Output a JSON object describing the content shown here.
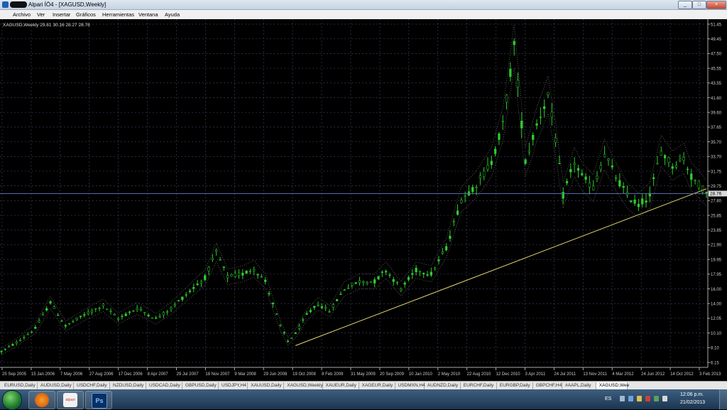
{
  "window": {
    "title": "Alpari ÍÖ4 - [XAGUSD,Weekly]",
    "controls": [
      "_",
      "□",
      "×"
    ]
  },
  "menu": [
    "Archivo",
    "Ver",
    "Insertar",
    "Gráficos",
    "Herramientas",
    "Ventana",
    "Ayuda"
  ],
  "chart_info": "XAGUSD,Weekly  29.81 30.16 28.27 28.76",
  "chart_data": {
    "type": "candlestick",
    "symbol": "XAGUSD",
    "timeframe": "Weekly",
    "last_ohlc": {
      "open": 29.81,
      "high": 30.16,
      "low": 28.27,
      "close": 28.76
    },
    "current_price_label": "28.76",
    "ylim": [
      6.15,
      51.45
    ],
    "y_ticks": [
      "51.45",
      "49.45",
      "47.50",
      "45.55",
      "43.55",
      "41.60",
      "39.60",
      "37.65",
      "35.70",
      "33.70",
      "31.75",
      "29.75",
      "27.80",
      "25.85",
      "23.85",
      "21.90",
      "19.95",
      "17.95",
      "16.00",
      "14.00",
      "12.05",
      "10.10",
      "8.10",
      "6.15"
    ],
    "x_ticks": [
      "25 Sep 2005",
      "15 Jan 2006",
      "7 May 2006",
      "27 Aug 2006",
      "17 Dec 2006",
      "8 Apr 2007",
      "29 Jul 2007",
      "18 Nov 2007",
      "9 Mar 2008",
      "29 Jun 2008",
      "19 Oct 2008",
      "8 Feb 2009",
      "31 May 2009",
      "20 Sep 2009",
      "10 Jan 2010",
      "2 May 2010",
      "22 Aug 2010",
      "12 Dec 2010",
      "3 Apr 2011",
      "24 Jul 2011",
      "13 Nov 2011",
      "4 Mar 2012",
      "24 Jun 2012",
      "14 Oct 2012",
      "3 Feb 2013"
    ],
    "price_path": [
      [
        0,
        7.6
      ],
      [
        4,
        8.8
      ],
      [
        9,
        10.7
      ],
      [
        13,
        14.2
      ],
      [
        17,
        11.0
      ],
      [
        22,
        12.5
      ],
      [
        27,
        13.8
      ],
      [
        31,
        12.0
      ],
      [
        36,
        13.4
      ],
      [
        41,
        12.0
      ],
      [
        45,
        13.4
      ],
      [
        50,
        15.7
      ],
      [
        54,
        17.5
      ],
      [
        57,
        20.9
      ],
      [
        60,
        17.6
      ],
      [
        64,
        18.0
      ],
      [
        67,
        18.7
      ],
      [
        70,
        17.0
      ],
      [
        72,
        14.0
      ],
      [
        74,
        11.0
      ],
      [
        76,
        9.0
      ],
      [
        78,
        10.0
      ],
      [
        81,
        12.5
      ],
      [
        84,
        14.0
      ],
      [
        87,
        13.0
      ],
      [
        91,
        16.0
      ],
      [
        95,
        17.0
      ],
      [
        99,
        17.0
      ],
      [
        102,
        18.5
      ],
      [
        106,
        16.0
      ],
      [
        110,
        18.5
      ],
      [
        114,
        18.0
      ],
      [
        118,
        21.5
      ],
      [
        122,
        28.0
      ],
      [
        126,
        30.0
      ],
      [
        130,
        33.0
      ],
      [
        133,
        38.0
      ],
      [
        136,
        48.5
      ],
      [
        139,
        33.0
      ],
      [
        142,
        38.0
      ],
      [
        145,
        42.0
      ],
      [
        147,
        36.0
      ],
      [
        149,
        28.5
      ],
      [
        152,
        33.0
      ],
      [
        154,
        31.0
      ],
      [
        157,
        29.5
      ],
      [
        160,
        34.0
      ],
      [
        163,
        31.0
      ],
      [
        166,
        28.5
      ],
      [
        169,
        27.2
      ],
      [
        172,
        28.5
      ],
      [
        175,
        34.5
      ],
      [
        178,
        32.5
      ],
      [
        181,
        33.5
      ],
      [
        183,
        31.0
      ],
      [
        185,
        30.0
      ],
      [
        187,
        28.8
      ]
    ],
    "trendline": {
      "from": [
        78,
        8.4
      ],
      "to": [
        187,
        29.4
      ],
      "color": "#e8d870"
    },
    "candle_color": "#2fcc2f",
    "envelope_color": "#8a8a8a",
    "grid": true,
    "grid_color": "#3a3a5a",
    "background": "#000000"
  },
  "tabs": [
    "EURUSD,Daily",
    "AUDUSD,Daily",
    "USDCHF,Daily",
    "NZDUSD,Daily",
    "USDCAD,Daily",
    "GBPUSD,Daily",
    "USDJPY,H4",
    "XAUUSD,Daily",
    "XAGUSD,Weekly",
    "XAUEUR,Daily",
    "XAGEUR,Daily",
    "USDMXN,H4",
    "AUDNZD,Daily",
    "EURCHF,Daily",
    "EURGBP,Daily",
    "GBPCHF,H4",
    "#AAPL,Daily",
    "XAGUSD,Wee"
  ],
  "active_tab": "XAGUSD,Wee",
  "taskbar": {
    "apps": [
      {
        "name": "firefox-icon",
        "label": ""
      },
      {
        "name": "alpari-icon",
        "label": "alpari"
      },
      {
        "name": "photoshop-icon",
        "label": "Ps"
      }
    ],
    "lang": "ES",
    "time": "12:06 p.m.",
    "date": "21/02/2013"
  }
}
